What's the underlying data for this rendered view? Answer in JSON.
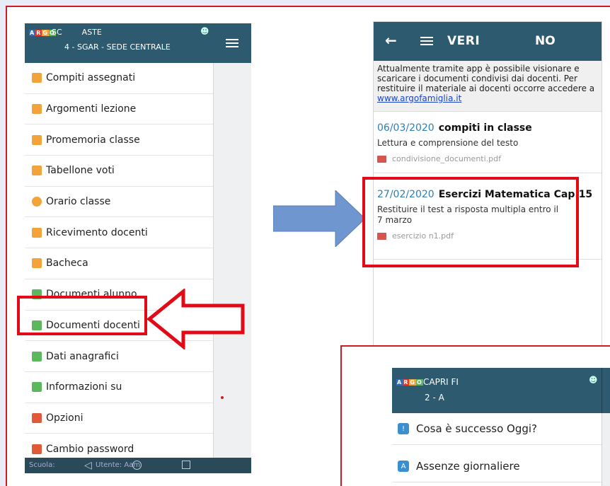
{
  "left_phone": {
    "argo_logo": "ARGO",
    "school_line1_a": "SC",
    "school_line1_b": "ASTE",
    "school_line2": "4 - SGAR - SEDE CENTRALE",
    "menu": [
      {
        "label": "Compiti assegnati",
        "icon": "tasks-icon",
        "color": "#f2a33a"
      },
      {
        "label": "Argomenti lezione",
        "icon": "book-icon",
        "color": "#f2a33a"
      },
      {
        "label": "Promemoria classe",
        "icon": "note-icon",
        "color": "#f2a33a"
      },
      {
        "label": "Tabellone voti",
        "icon": "grid-icon",
        "color": "#f2a33a"
      },
      {
        "label": "Orario classe",
        "icon": "clock-icon",
        "color": "#f2a33a"
      },
      {
        "label": "Ricevimento docenti",
        "icon": "meeting-icon",
        "color": "#f2a33a"
      },
      {
        "label": "Bacheca",
        "icon": "board-icon",
        "color": "#f2a33a"
      },
      {
        "label": "Documenti alunno",
        "icon": "document-icon",
        "color": "#5bb85d"
      },
      {
        "label": "Documenti docenti",
        "icon": "document-icon",
        "color": "#5bb85d"
      },
      {
        "label": "Dati anagrafici",
        "icon": "id-card-icon",
        "color": "#5bb85d"
      },
      {
        "label": "Informazioni su",
        "icon": "info-icon",
        "color": "#5bb85d"
      },
      {
        "label": "Opzioni",
        "icon": "wrench-icon",
        "color": "#e05a3a"
      },
      {
        "label": "Cambio password",
        "icon": "key-icon",
        "color": "#e05a3a"
      }
    ],
    "footer_school": "Scuola:",
    "footer_user": "Utente: Aam"
  },
  "right_phone": {
    "title_part1": "VERI",
    "title_part2": "NO",
    "notice_text": "Attualmente tramite app è possibile visionare e scaricare i documenti condivisi dai docenti. Per restituire il materiale ai docenti occorre accedere a",
    "notice_link": "www.argofamiglia.it",
    "documents": [
      {
        "date": "06/03/2020",
        "name": "compiti in classe",
        "description": "Lettura e comprensione del testo",
        "file": "condivisione_documenti.pdf"
      },
      {
        "date": "27/02/2020",
        "name": "Esercizi Matematica Cap.15",
        "description": "Restituire il test a risposta multipla entro il 7 marzo",
        "file": "esercizio n1.pdf"
      }
    ]
  },
  "inset_phone": {
    "argo_logo": "ARGO",
    "student_name": "CAPRI FI",
    "class_name": "2 - A",
    "items": [
      {
        "label": "Cosa è successo Oggi?",
        "icon": "exclamation-icon"
      },
      {
        "label": "Assenze giornaliere",
        "icon": "absence-icon"
      }
    ]
  },
  "colors": {
    "header": "#2d5a6e",
    "highlight": "#e20a16",
    "arrow_blue": "#6f96cf",
    "date_blue": "#2c7fb8"
  }
}
